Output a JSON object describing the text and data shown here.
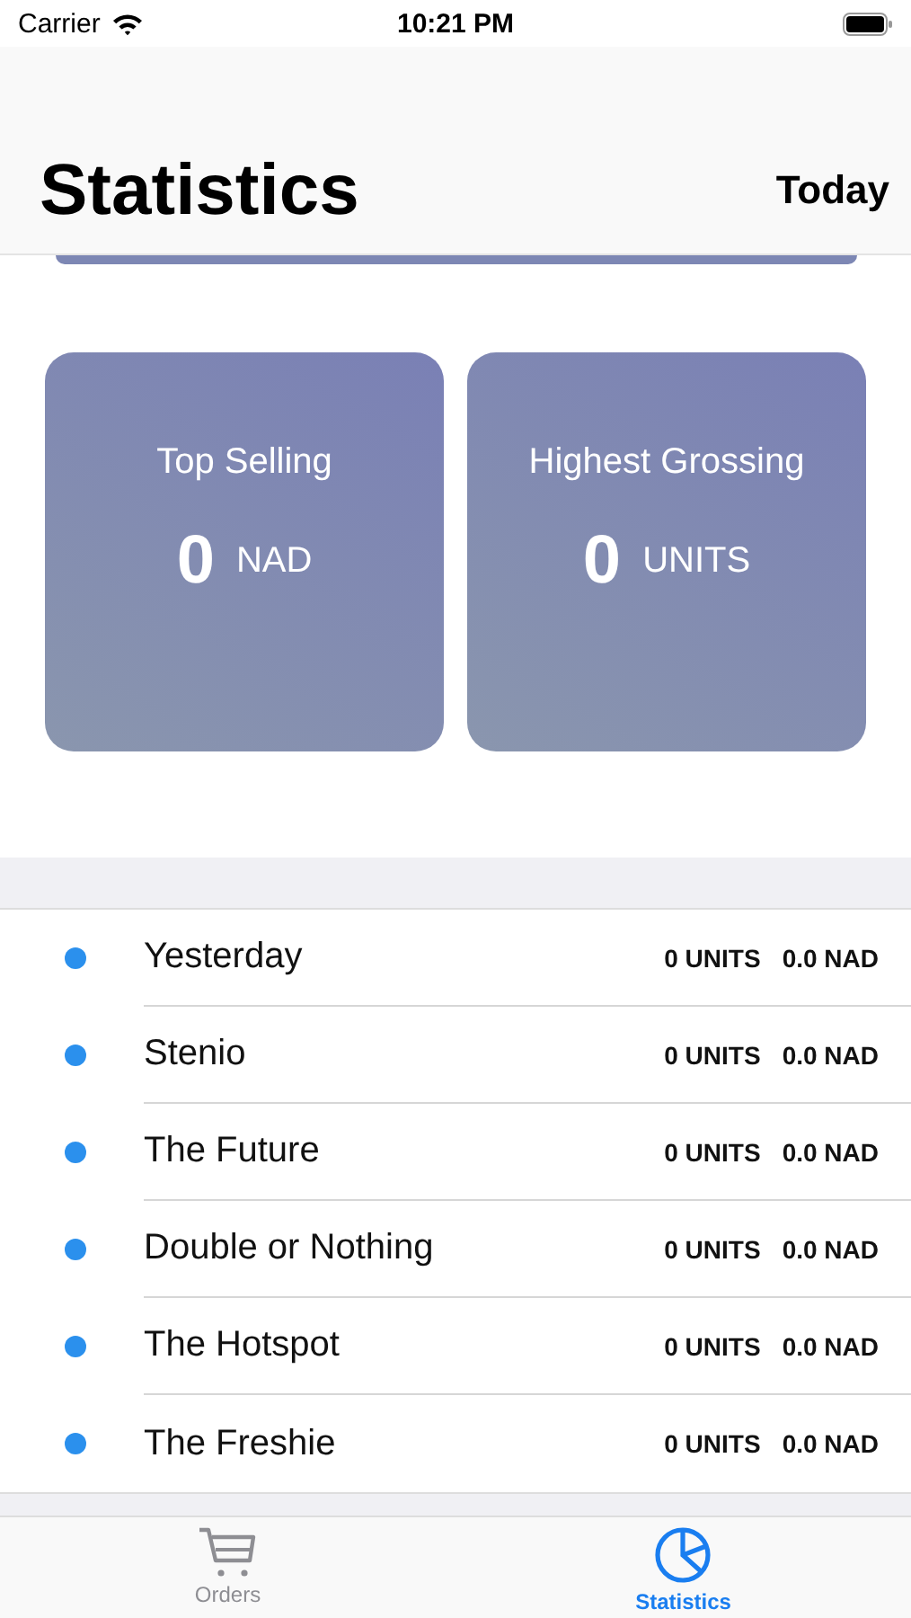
{
  "status_bar": {
    "carrier": "Carrier",
    "time": "10:21 PM"
  },
  "nav": {
    "title": "Statistics",
    "action": "Today"
  },
  "cards": [
    {
      "title": "Top Selling",
      "value": "0",
      "unit": "NAD"
    },
    {
      "title": "Highest Grossing",
      "value": "0",
      "unit": "UNITS"
    }
  ],
  "list": [
    {
      "name": "Yesterday",
      "units": "0 UNITS",
      "amount": "0.0 NAD"
    },
    {
      "name": "Stenio",
      "units": "0 UNITS",
      "amount": "0.0 NAD"
    },
    {
      "name": "The Future",
      "units": "0 UNITS",
      "amount": "0.0 NAD"
    },
    {
      "name": "Double or Nothing",
      "units": "0 UNITS",
      "amount": "0.0 NAD"
    },
    {
      "name": "The Hotspot",
      "units": "0 UNITS",
      "amount": "0.0 NAD"
    },
    {
      "name": "The Freshie",
      "units": "0 UNITS",
      "amount": "0.0 NAD"
    }
  ],
  "tabs": [
    {
      "label": "Orders",
      "kind": "cart",
      "selected": false
    },
    {
      "label": "Statistics",
      "kind": "chart",
      "selected": true
    }
  ]
}
